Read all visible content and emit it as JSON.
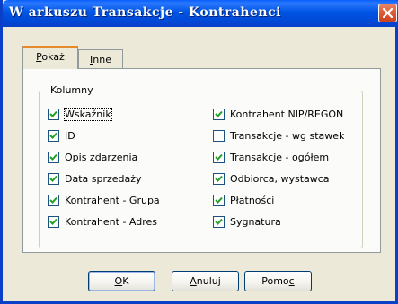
{
  "window": {
    "title": "W arkuszu Transakcje - Kontrahenci"
  },
  "tabs": [
    {
      "label_pre": "",
      "label_u": "P",
      "label_post": "okaż"
    },
    {
      "label_pre": "",
      "label_u": "I",
      "label_post": "nne"
    }
  ],
  "group": {
    "title": "Kolumny"
  },
  "checkboxes_left": [
    {
      "label": "Wskaźnik",
      "checked": true
    },
    {
      "label": "ID",
      "checked": true
    },
    {
      "label": "Opis zdarzenia",
      "checked": true
    },
    {
      "label": "Data sprzedaży",
      "checked": true
    },
    {
      "label": "Kontrahent - Grupa",
      "checked": true
    },
    {
      "label": "Kontrahent - Adres",
      "checked": true
    }
  ],
  "checkboxes_right": [
    {
      "label": "Kontrahent NIP/REGON",
      "checked": true
    },
    {
      "label": "Transakcje - wg stawek",
      "checked": false
    },
    {
      "label": "Transakcje - ogółem",
      "checked": true
    },
    {
      "label": "Odbiorca, wystawca",
      "checked": true
    },
    {
      "label": "Płatności",
      "checked": true
    },
    {
      "label": "Sygnatura",
      "checked": true
    }
  ],
  "buttons": {
    "ok": {
      "pre": "",
      "u": "O",
      "post": "K"
    },
    "cancel": {
      "pre": "",
      "u": "A",
      "post": "nuluj"
    },
    "help": {
      "pre": "Pomo",
      "u": "c",
      "post": ""
    }
  }
}
